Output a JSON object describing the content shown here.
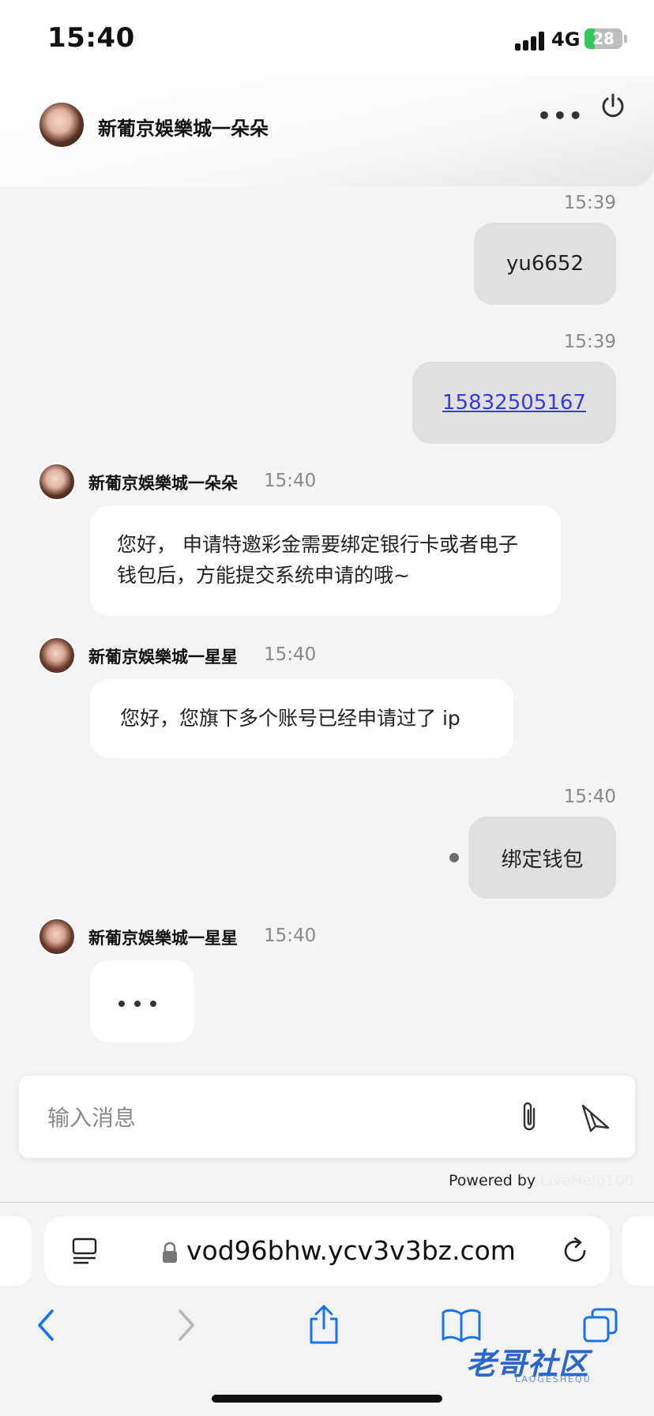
{
  "status_bar": {
    "time": "15:40",
    "network": "4G",
    "battery_level": "28",
    "battery_fraction": 0.28
  },
  "header": {
    "title": "新葡京娛樂城一朵朵",
    "more_icon": "ellipsis-icon",
    "power_icon": "power-icon"
  },
  "messages": {
    "m1": {
      "time": "15:39",
      "text": "yu6652"
    },
    "m2": {
      "time": "15:39",
      "text": "15832505167"
    },
    "m3": {
      "sender": "新葡京娛樂城一朵朵",
      "time": "15:40",
      "text": "您好， 申请特邀彩金需要绑定银行卡或者电子钱包后，方能提交系统申请的哦~"
    },
    "m4": {
      "sender": "新葡京娛樂城一星星",
      "time": "15:40",
      "text": "您好，您旗下多个账号已经申请过了 ip"
    },
    "m5": {
      "time": "15:40",
      "text": "绑定钱包"
    },
    "m6": {
      "sender": "新葡京娛樂城一星星",
      "time": "15:40"
    }
  },
  "composer": {
    "placeholder": "输入消息",
    "attach_icon": "paperclip-icon",
    "send_icon": "send-icon"
  },
  "powered_by": {
    "label": "Powered by",
    "brand": "LiveHelp100"
  },
  "browser": {
    "url": "vod96bhw.ycv3v3bz.com"
  },
  "watermark": {
    "text": "老哥社区",
    "sub": "LAOGESHEQU"
  },
  "colors": {
    "link": "#3a3ad6",
    "outgoing_bubble": "#e0e0e0",
    "incoming_bubble": "#ffffff",
    "safari_blue": "#1a73e8"
  }
}
